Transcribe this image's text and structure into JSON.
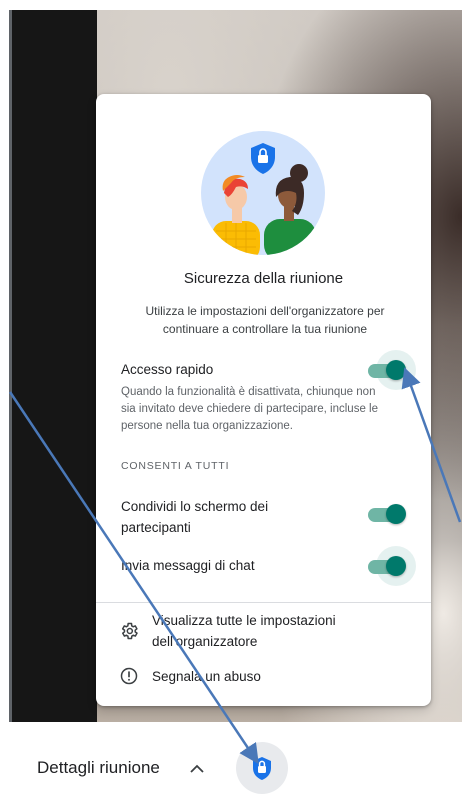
{
  "dialog": {
    "title": "Sicurezza della riunione",
    "subtitle": "Utilizza le impostazioni dell'organizzatore per continuare a controllare la tua riunione",
    "quick_access": {
      "label": "Accesso rapido",
      "description": "Quando la funzionalità è disattivata, chiunque non sia invitato deve chiedere di partecipare, incluse le persone nella tua organizzazione.",
      "enabled": true
    },
    "section_heading": "CONSENTI A TUTTI",
    "share_screen": {
      "label": "Condividi lo schermo dei partecipanti",
      "enabled": true
    },
    "chat": {
      "label": "Invia messaggi di chat",
      "enabled": true
    },
    "actions": {
      "view_settings": "Visualizza tutte le impostazioni dell'organizzatore",
      "report_abuse": "Segnala un abuso"
    }
  },
  "bottom_bar": {
    "meeting_details": "Dettagli riunione"
  },
  "colors": {
    "toggle_on": "#00796b",
    "toggle_track": "#6fb5a5",
    "shield_blue": "#1a73e8",
    "annotation_arrow": "#4a78b8"
  },
  "icons": {
    "shield": "shield-lock-icon",
    "settings": "gear-icon",
    "report": "exclamation-circle-icon",
    "caret": "chevron-up-icon"
  }
}
